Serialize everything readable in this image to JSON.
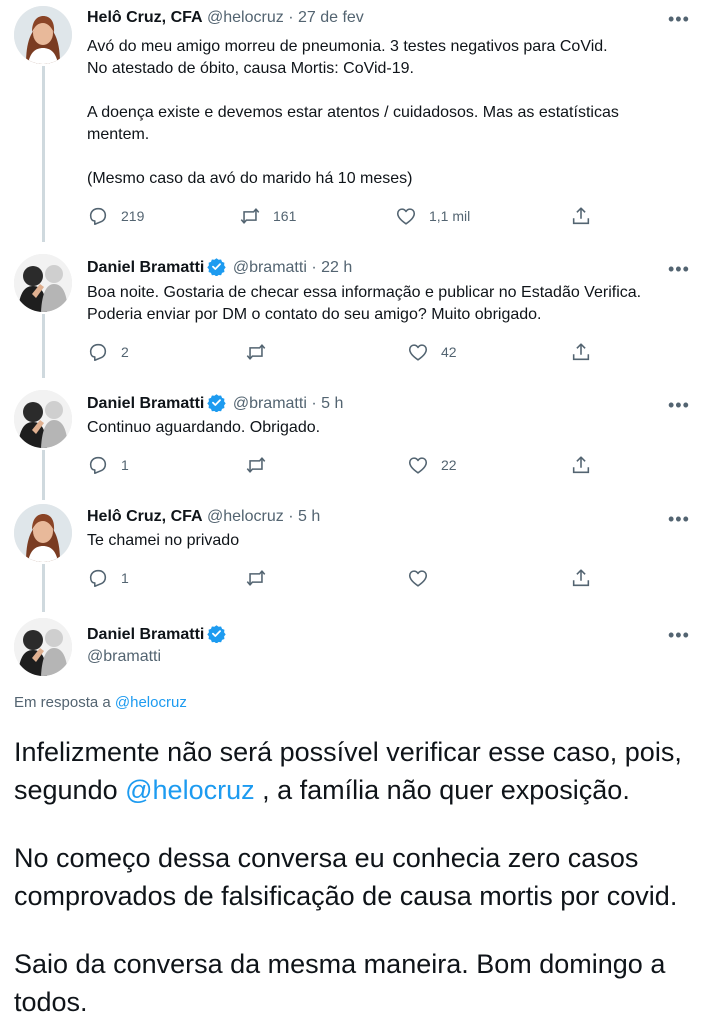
{
  "tweets": [
    {
      "name": "Helô Cruz, CFA",
      "handle": "@helocruz",
      "sep": "·",
      "time": "27 de fev",
      "lines": [
        "Avó do meu amigo morreu de pneumonia. 3 testes negativos para CoVid.",
        "No atestado de óbito, causa Mortis: CoVid-19.",
        "A doença existe e devemos estar atentos / cuidadosos. Mas as estatísticas",
        "mentem.",
        "(Mesmo caso da avó do marido há 10 meses)"
      ],
      "replies": "219",
      "retweets": "161",
      "likes": "1,1 mil"
    },
    {
      "name": "Daniel Bramatti",
      "handle": "@bramatti",
      "sep": "·",
      "time": "22 h",
      "lines": [
        "Boa noite. Gostaria de checar essa informação e publicar no Estadão Verifica.",
        "Poderia enviar por DM o contato do seu amigo? Muito obrigado."
      ],
      "replies": "2",
      "retweets": "",
      "likes": "42"
    },
    {
      "name": "Daniel Bramatti",
      "handle": "@bramatti",
      "sep": "·",
      "time": "5 h",
      "lines": [
        "Continuo aguardando. Obrigado."
      ],
      "replies": "1",
      "retweets": "",
      "likes": "22"
    },
    {
      "name": "Helô Cruz, CFA",
      "handle": "@helocruz",
      "sep": "·",
      "time": "5 h",
      "lines": [
        "Te chamei no privado"
      ],
      "replies": "1",
      "retweets": "",
      "likes": ""
    }
  ],
  "main_tweet": {
    "name": "Daniel Bramatti",
    "handle": "@bramatti",
    "reply_to_prefix": "Em resposta a",
    "reply_to_handle": "@helocruz",
    "p1_line1": "Infelizmente não será possível verificar esse caso, pois,",
    "p1_line2_a": "segundo",
    "p1_mention": "@helocruz",
    "p1_line2_b": ", a família não quer exposição.",
    "p2_line1": "No começo dessa conversa eu conhecia zero casos",
    "p2_line2": "comprovados de falsificação de causa mortis por covid.",
    "p3_line1": "Saio da conversa da mesma maneira.  Bom domingo a",
    "p3_line2": "todos."
  },
  "icons": {
    "more": "more-icon",
    "reply": "reply-icon",
    "retweet": "retweet-icon",
    "like": "like-icon",
    "share": "share-icon",
    "verified": "verified-badge-icon"
  },
  "colors": {
    "verified": "#1d9bf0",
    "mention": "#1d9bf0",
    "secondary_text": "#536471",
    "thread_line": "#cfd9de"
  }
}
